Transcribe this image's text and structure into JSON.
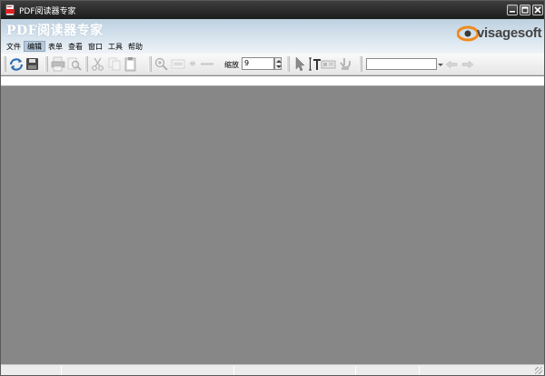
{
  "window": {
    "title": "PDF阅读器专家"
  },
  "banner": {
    "title": "PDF阅读器专家",
    "logo_text": "visagesoft"
  },
  "menu": {
    "items": [
      {
        "label": "文件",
        "active": false
      },
      {
        "label": "编辑",
        "active": true
      },
      {
        "label": "表单",
        "active": false
      },
      {
        "label": "查看",
        "active": false
      },
      {
        "label": "窗口",
        "active": false
      },
      {
        "label": "工具",
        "active": false
      },
      {
        "label": "帮助",
        "active": false
      }
    ]
  },
  "toolbar": {
    "zoom_label": "缩放",
    "zoom_value": "9",
    "search_value": "",
    "icons": [
      "open-icon",
      "save-icon",
      "print-icon",
      "print-preview-icon",
      "cut-icon",
      "copy-icon",
      "paste-icon",
      "zoom-in-icon",
      "actual-size-icon",
      "zoom-out-icon",
      "fit-width-icon",
      "select-pointer-icon",
      "text-select-icon",
      "snapshot-icon",
      "hand-tool-icon",
      "prev-page-icon",
      "next-page-icon"
    ]
  },
  "colors": {
    "titlebar": "#262626",
    "banner_top": "#bcd0e0",
    "document_bg": "#878787",
    "logo_orange": "#f08a1c"
  }
}
